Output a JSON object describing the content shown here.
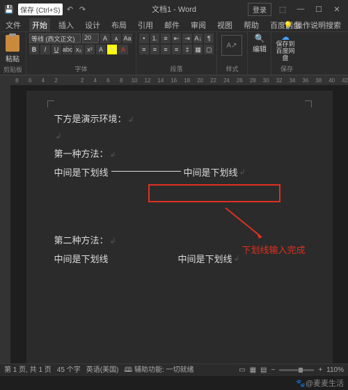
{
  "titlebar": {
    "save_tooltip": "保存 (Ctrl+S)",
    "title": "文档1 - Word",
    "login": "登录"
  },
  "tabs": {
    "file": "文件",
    "home": "开始",
    "insert": "插入",
    "design": "设计",
    "layout": "布局",
    "references": "引用",
    "mailings": "邮件",
    "review": "审阅",
    "view": "视图",
    "help": "帮助",
    "baidu": "百度网盘",
    "tell_me": "操作说明搜索"
  },
  "ribbon": {
    "clipboard": {
      "paste": "粘贴",
      "label": "剪贴板"
    },
    "font": {
      "name": "等线 (西文正文)",
      "size": "20",
      "label": "字体"
    },
    "paragraph": {
      "label": "段落"
    },
    "styles": {
      "label": "样式",
      "sample": "A↗"
    },
    "editing": {
      "label": "编辑"
    },
    "save": {
      "line1": "保存到",
      "line2": "百度网盘",
      "label": "保存"
    }
  },
  "ruler": {
    "marks": [
      "8",
      "6",
      "4",
      "2",
      "",
      "2",
      "4",
      "6",
      "8",
      "10",
      "12",
      "14",
      "16",
      "18",
      "20",
      "22",
      "24",
      "26",
      "28",
      "30",
      "32",
      "34",
      "36",
      "38",
      "40",
      "42"
    ]
  },
  "document": {
    "para1": "下方是演示环境：",
    "para2": "第一种方法：",
    "para3a": "中间是下划线",
    "para3b": "中间是下划线",
    "para4": "第二种方法：",
    "para5a": "中间是下划线",
    "para5b": "中间是下划线",
    "annotation": "下划线输入完成"
  },
  "status": {
    "page": "第 1 页, 共 1 页",
    "words": "45 个字",
    "lang": "英语(美国)",
    "accessibility": "辅助功能: 一切就绪",
    "zoom": "110%"
  },
  "watermark": "@麦麦生活"
}
